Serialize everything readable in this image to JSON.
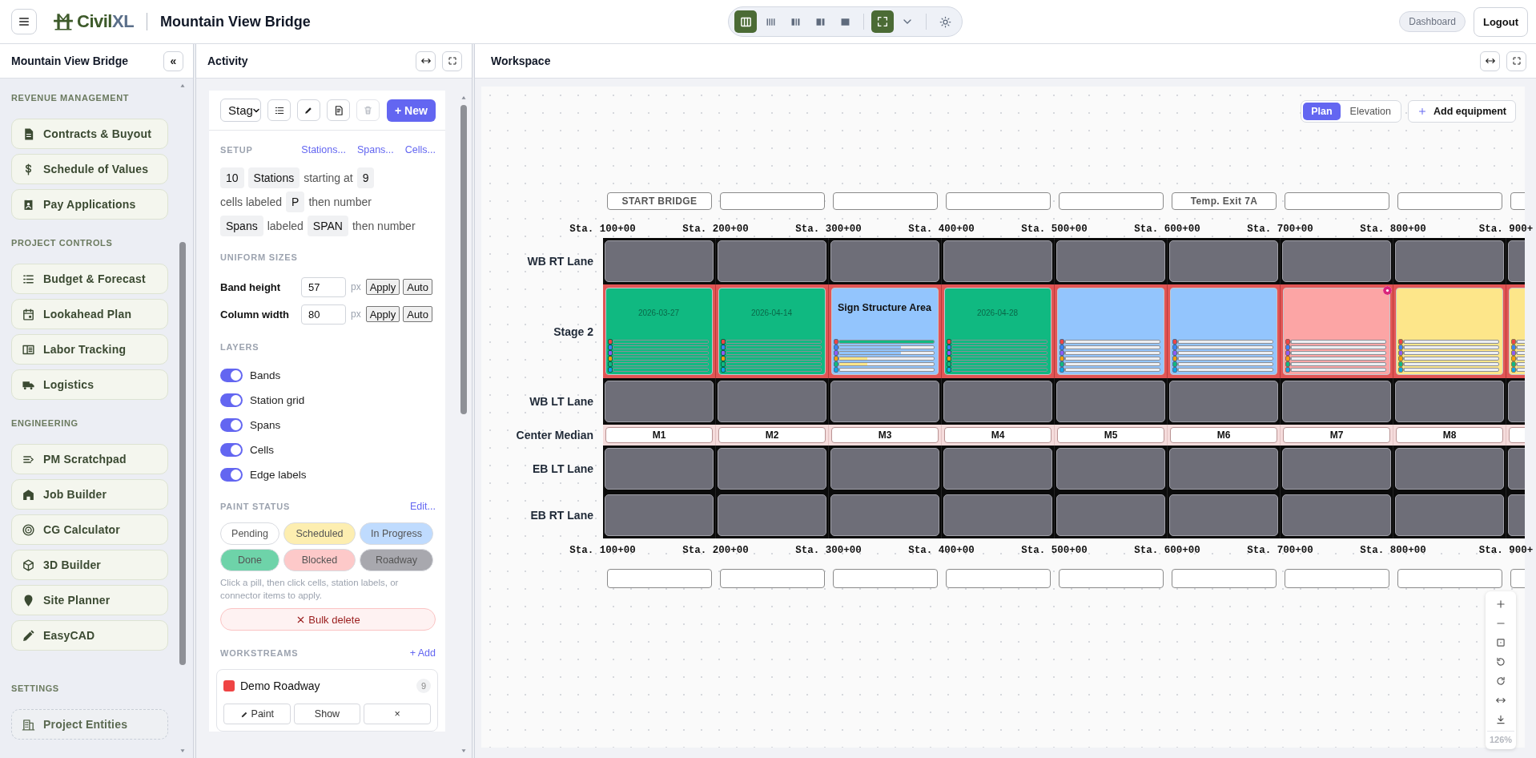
{
  "topbar": {
    "logo": {
      "name": "Civil",
      "suffix": "XL"
    },
    "project_title": "Mountain View Bridge",
    "layout_modes": [
      {
        "selected": true
      },
      {
        "selected": false
      },
      {
        "selected": false
      },
      {
        "selected": false
      },
      {
        "selected": false
      }
    ],
    "focus_mode": {
      "on": true
    },
    "dashboard": "Dashboard",
    "logout": "Logout"
  },
  "sidebar": {
    "title": "Mountain View Bridge",
    "collapse": "«",
    "sections": [
      {
        "title": "REVENUE MANAGEMENT",
        "items": [
          {
            "label": "Contracts & Buyout",
            "dashed": false
          },
          {
            "label": "Schedule of Values",
            "dashed": false
          },
          {
            "label": "Pay Applications",
            "dashed": false
          }
        ]
      },
      {
        "title": "PROJECT CONTROLS",
        "items": [
          {
            "label": "Budget & Forecast",
            "dashed": false
          },
          {
            "label": "Lookahead Plan",
            "dashed": false
          },
          {
            "label": "Labor Tracking",
            "dashed": false
          },
          {
            "label": "Logistics",
            "dashed": false
          }
        ]
      },
      {
        "title": "ENGINEERING",
        "items": [
          {
            "label": "PM Scratchpad",
            "dashed": false
          },
          {
            "label": "Job Builder",
            "dashed": false
          },
          {
            "label": "CG Calculator",
            "dashed": false
          },
          {
            "label": "3D Builder",
            "dashed": false
          },
          {
            "label": "Site Planner",
            "dashed": false
          },
          {
            "label": "EasyCAD",
            "dashed": false
          }
        ]
      },
      {
        "title": "SETTINGS",
        "items": [
          {
            "label": "Project Entities",
            "dashed": true
          }
        ]
      }
    ]
  },
  "activity": {
    "title": "Activity",
    "toolbar": {
      "select": "Stag",
      "new_button": "+ New",
      "delete_disabled": true
    },
    "setup": {
      "title": "SETUP",
      "links": [
        "Stations...",
        "Spans...",
        "Cells..."
      ],
      "station_count": "10",
      "station_unit": "Stations",
      "starting_at_label": "starting at",
      "start_value": "9",
      "cells_label": "cells labeled",
      "cell_prefix": "P",
      "cells_suffix": "then number",
      "spans_unit": "Spans",
      "spans_label": "labeled",
      "span_prefix": "SPAN",
      "spans_suffix": "then number"
    },
    "sizes": {
      "title": "UNIFORM SIZES",
      "rows": [
        {
          "label": "Band height",
          "value": "57",
          "unit": "px",
          "apply": "Apply",
          "auto": "Auto"
        },
        {
          "label": "Column width",
          "value": "80",
          "unit": "px",
          "apply": "Apply",
          "auto": "Auto"
        }
      ]
    },
    "layers": {
      "title": "LAYERS",
      "items": [
        {
          "label": "Bands",
          "on": true
        },
        {
          "label": "Station grid",
          "on": true
        },
        {
          "label": "Spans",
          "on": true
        },
        {
          "label": "Cells",
          "on": true
        },
        {
          "label": "Edge labels",
          "on": true
        }
      ]
    },
    "paint_status": {
      "title": "PAINT STATUS",
      "edit": "Edit...",
      "pills": [
        {
          "label": "Pending",
          "color": "#ffffff",
          "selected": false
        },
        {
          "label": "Scheduled",
          "color": "#fdeeb0",
          "selected": false
        },
        {
          "label": "In Progress",
          "color": "#bfdbfe",
          "selected": false
        },
        {
          "label": "Done",
          "color": "#6ed3a9",
          "selected": false
        },
        {
          "label": "Blocked",
          "color": "#fdc9c9",
          "selected": false
        },
        {
          "label": "Roadway",
          "color": "#a8a8ae",
          "selected": false
        }
      ],
      "hint": "Click a pill, then click cells, station labels, or connector items to apply.",
      "bulk_delete": "Bulk delete"
    },
    "workstreams": {
      "title": "WORKSTREAMS",
      "add": "+ Add",
      "items": [
        {
          "name": "Demo Roadway",
          "color": "#ef4444",
          "count": "9",
          "paint": "Paint",
          "show": "Show",
          "remove": "×"
        }
      ]
    }
  },
  "workspace": {
    "title": "Workspace",
    "views": [
      {
        "label": "Plan",
        "selected": true
      },
      {
        "label": "Elevation",
        "selected": false
      }
    ],
    "add_equipment": "Add equipment",
    "zoom": "126%",
    "board": {
      "top_markers": [
        {
          "kind": "labeled",
          "text": "START BRIDGE"
        },
        {
          "kind": "blank"
        },
        {
          "kind": "blank"
        },
        {
          "kind": "blank"
        },
        {
          "kind": "blank"
        },
        {
          "kind": "labeled",
          "text": "Temp. Exit 7A"
        },
        {
          "kind": "blank"
        },
        {
          "kind": "blank"
        },
        {
          "kind": "blank"
        }
      ],
      "stations_top": [
        "Sta. 100+00",
        "Sta. 200+00",
        "Sta. 300+00",
        "Sta. 400+00",
        "Sta. 500+00",
        "Sta. 600+00",
        "Sta. 700+00",
        "Sta. 800+00",
        "Sta. 900+"
      ],
      "bar_dots": [
        {
          "color": "#ef4444"
        },
        {
          "color": "#3b82f6"
        },
        {
          "color": "#8b5cf6"
        },
        {
          "color": "#f59e0b"
        },
        {
          "color": "#10b981"
        },
        {
          "color": "#0ea5e9"
        }
      ],
      "rows": [
        {
          "label": "WB RT Lane",
          "kind": "lane"
        },
        {
          "label": "Stage 2",
          "kind": "stage",
          "cells": [
            {
              "color": "#10b981",
              "date": "2026-03-27",
              "flagged": false,
              "bars": [
                {
                  "level": 1,
                  "color": "#10b981"
                },
                {
                  "level": 1,
                  "color": "#10b981"
                },
                {
                  "level": 1,
                  "color": "#10b981"
                },
                {
                  "level": 1,
                  "color": "#10b981"
                },
                {
                  "level": 1,
                  "color": "#10b981"
                },
                {
                  "level": 1,
                  "color": "#10b981"
                }
              ]
            },
            {
              "color": "#10b981",
              "date": "2026-04-14",
              "flagged": false,
              "bars": [
                {
                  "level": 1,
                  "color": "#10b981"
                },
                {
                  "level": 1,
                  "color": "#10b981"
                },
                {
                  "level": 1,
                  "color": "#10b981"
                },
                {
                  "level": 1,
                  "color": "#10b981"
                },
                {
                  "level": 1,
                  "color": "#10b981"
                },
                {
                  "level": 1,
                  "color": "#10b981"
                }
              ]
            },
            {
              "color": "#93c5fd",
              "title": "Sign Structure Area",
              "flagged": false,
              "bars": [
                {
                  "level": 1,
                  "color": "#10b981"
                },
                {
                  "level": 0.65,
                  "color": "#93c5fd"
                },
                {
                  "level": 0.65,
                  "color": "#93c5fd"
                },
                {
                  "level": 0.3,
                  "color": "#fde68a"
                },
                {
                  "level": 0.3,
                  "color": "#fde68a"
                },
                {
                  "level": 0
                }
              ]
            },
            {
              "color": "#10b981",
              "date": "2026-04-28",
              "flagged": false,
              "bars": [
                {
                  "level": 1,
                  "color": "#10b981"
                },
                {
                  "level": 1,
                  "color": "#10b981"
                },
                {
                  "level": 1,
                  "color": "#10b981"
                },
                {
                  "level": 1,
                  "color": "#10b981"
                },
                {
                  "level": 1,
                  "color": "#10b981"
                },
                {
                  "level": 1,
                  "color": "#10b981"
                }
              ]
            },
            {
              "color": "#93c5fd",
              "flagged": false,
              "bars": [
                {
                  "level": 0
                },
                {
                  "level": 0
                },
                {
                  "level": 0
                },
                {
                  "level": 0
                },
                {
                  "level": 0
                },
                {
                  "level": 0
                }
              ]
            },
            {
              "color": "#93c5fd",
              "flagged": false,
              "bars": [
                {
                  "level": 0
                },
                {
                  "level": 0
                },
                {
                  "level": 0
                },
                {
                  "level": 0
                },
                {
                  "level": 0
                },
                {
                  "level": 0
                }
              ]
            },
            {
              "color": "#fca5a5",
              "flagged": true,
              "bars": [
                {
                  "level": 0
                },
                {
                  "level": 0
                },
                {
                  "level": 0
                },
                {
                  "level": 0
                },
                {
                  "level": 0
                },
                {
                  "level": 0
                }
              ]
            },
            {
              "color": "#fde68a",
              "flagged": false,
              "bars": [
                {
                  "level": 0
                },
                {
                  "level": 0
                },
                {
                  "level": 0
                },
                {
                  "level": 0
                },
                {
                  "level": 0
                },
                {
                  "level": 0
                }
              ]
            },
            {
              "color": "#fde68a",
              "flagged": false,
              "bars": [
                {
                  "level": 0
                },
                {
                  "level": 0
                },
                {
                  "level": 0
                },
                {
                  "level": 0
                },
                {
                  "level": 0
                },
                {
                  "level": 0
                }
              ]
            }
          ]
        },
        {
          "label": "WB LT Lane",
          "kind": "lane"
        },
        {
          "label": "Center Median",
          "kind": "median",
          "cells": [
            {
              "kind": "labeled",
              "text": "M1"
            },
            {
              "kind": "labeled",
              "text": "M2"
            },
            {
              "kind": "labeled",
              "text": "M3"
            },
            {
              "kind": "labeled",
              "text": "M4"
            },
            {
              "kind": "labeled",
              "text": "M5"
            },
            {
              "kind": "labeled",
              "text": "M6"
            },
            {
              "kind": "labeled",
              "text": "M7"
            },
            {
              "kind": "labeled",
              "text": "M8"
            },
            {
              "kind": "blank"
            }
          ]
        },
        {
          "label": "EB LT Lane",
          "kind": "lane"
        },
        {
          "label": "EB RT Lane",
          "kind": "lane"
        }
      ],
      "stations_bottom": [
        "Sta. 100+00",
        "Sta. 200+00",
        "Sta. 300+00",
        "Sta. 400+00",
        "Sta. 500+00",
        "Sta. 600+00",
        "Sta. 700+00",
        "Sta. 800+00",
        "Sta. 900+"
      ],
      "bottom_markers": [
        {
          "kind": "blank"
        },
        {
          "kind": "blank"
        },
        {
          "kind": "blank"
        },
        {
          "kind": "blank"
        },
        {
          "kind": "blank"
        },
        {
          "kind": "blank"
        },
        {
          "kind": "blank"
        },
        {
          "kind": "blank"
        },
        {
          "kind": "blank"
        }
      ]
    }
  }
}
